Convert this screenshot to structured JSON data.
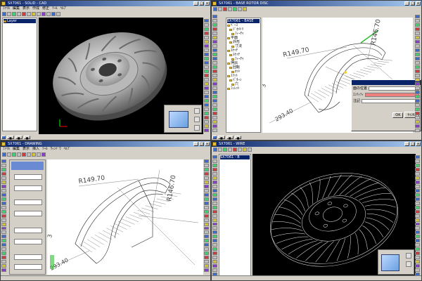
{
  "quadrants": {
    "q1": {
      "title": "SX7061  - SOLID - CAD",
      "menu": [
        "ﾌｧｲﾙ",
        "編集",
        "表示",
        "作成",
        "修正",
        "ﾂｰﾙ",
        "ﾍﾙﾌﾟ"
      ],
      "tree_root": "Layer"
    },
    "q2": {
      "title": "SX7061 - BASE ROTOR DISC",
      "tree_header": "SX7061 - BASE",
      "tree_items": [
        "ﾍﾞｰｽ",
        "ｼﾞｵﾒﾄﾘ",
        "ﾌｨｰﾁｬ",
        "平面",
        "外形",
        "寸法",
        "ｽｹｯﾁ",
        "ｽｹｯﾁ",
        "ﾌｨｰﾁｬ",
        "押出",
        "回転",
        "ｶｯﾄ",
        "ｽﾘｯﾄ",
        "ﾊﾟﾀｰﾝ",
        "穴",
        "ﾌｨﾚｯﾄ"
      ],
      "dims": {
        "r1": "R149.70",
        "r2": "R146.70",
        "d1": "293.40",
        "n": "3"
      },
      "dialog": {
        "label1": "面の位置",
        "label2": "ｴﾝﾃｨﾃｨ",
        "label3": "注記",
        "ok": "OK",
        "cancel": "ｷｬﾝｾﾙ"
      }
    },
    "q3": {
      "title": "SX7061 - DRAWING",
      "menu": [
        "ﾌｧｲﾙ",
        "編集",
        "表示",
        "挿入",
        "ﾂｰﾙ",
        "ｳｨﾝﾄﾞｳ",
        "ﾍﾙﾌﾟ"
      ],
      "dims": {
        "r1": "R149.70",
        "r2": "R146.70",
        "d1": "293.40",
        "n": "3"
      }
    },
    "q4": {
      "title": "SX7061 - WIRE",
      "tree_header": "SX7061 - B"
    }
  },
  "colors": {
    "titlebar": "#0a246a",
    "viewport_black": "#000000",
    "pink_field": "#f08080",
    "green_highlight": "#30c030"
  }
}
